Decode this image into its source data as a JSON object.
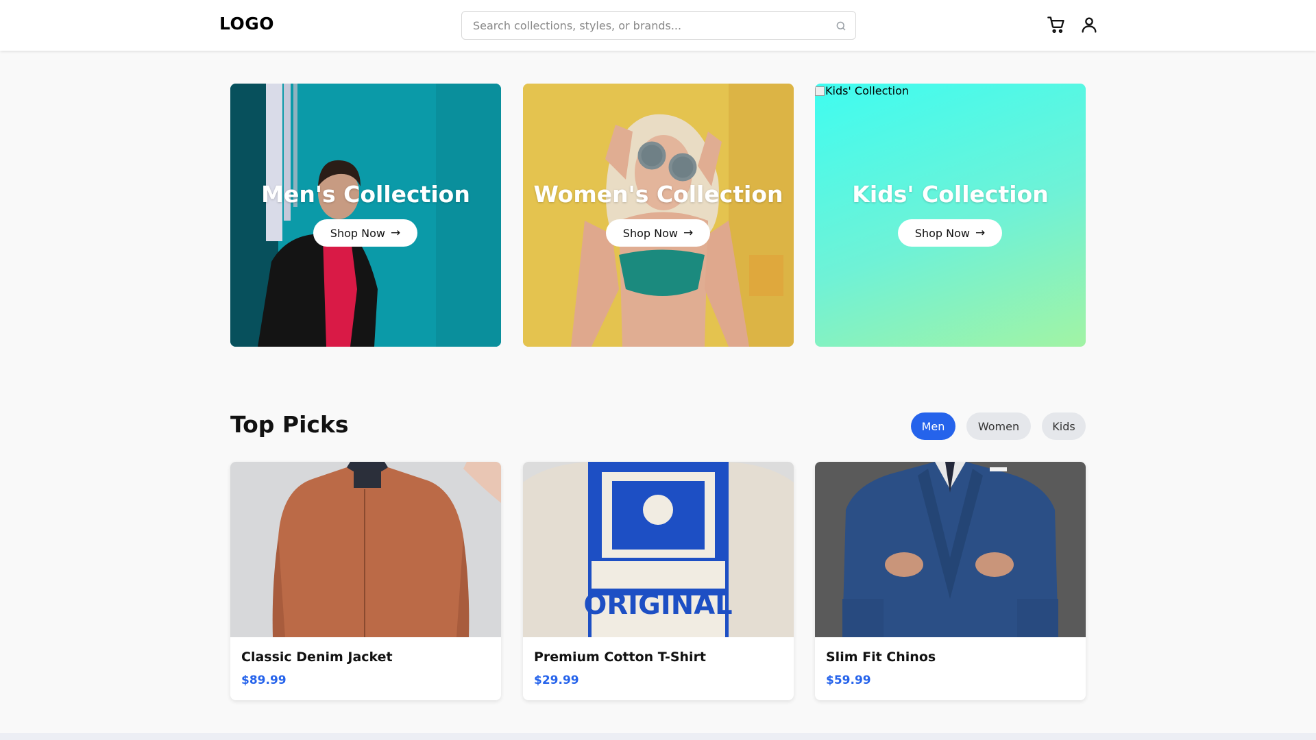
{
  "header": {
    "logo": "LOGO",
    "search_placeholder": "Search collections, styles, or brands...",
    "icons": [
      "search-icon",
      "cart-icon",
      "user-icon"
    ]
  },
  "collections": [
    {
      "title": "Men's Collection",
      "button": "Shop Now",
      "arrow": "→"
    },
    {
      "title": "Women's Collection",
      "button": "Shop Now",
      "arrow": "→"
    },
    {
      "title": "Kids' Collection",
      "button": "Shop Now",
      "arrow": "→",
      "image_alt": "Kids' Collection"
    }
  ],
  "top_picks": {
    "title": "Top Picks",
    "filters": [
      "Men",
      "Women",
      "Kids"
    ],
    "active_filter": "Men",
    "products": [
      {
        "name": "Classic Denim Jacket",
        "price": "$89.99"
      },
      {
        "name": "Premium Cotton T-Shirt",
        "price": "$29.99"
      },
      {
        "name": "Slim Fit Chinos",
        "price": "$59.99"
      }
    ],
    "tshirt_print": "ORIGINAL"
  },
  "colors": {
    "accent": "#2563eb",
    "filter_inactive": "#e5e7eb",
    "page_bg": "#f9f9f9"
  }
}
